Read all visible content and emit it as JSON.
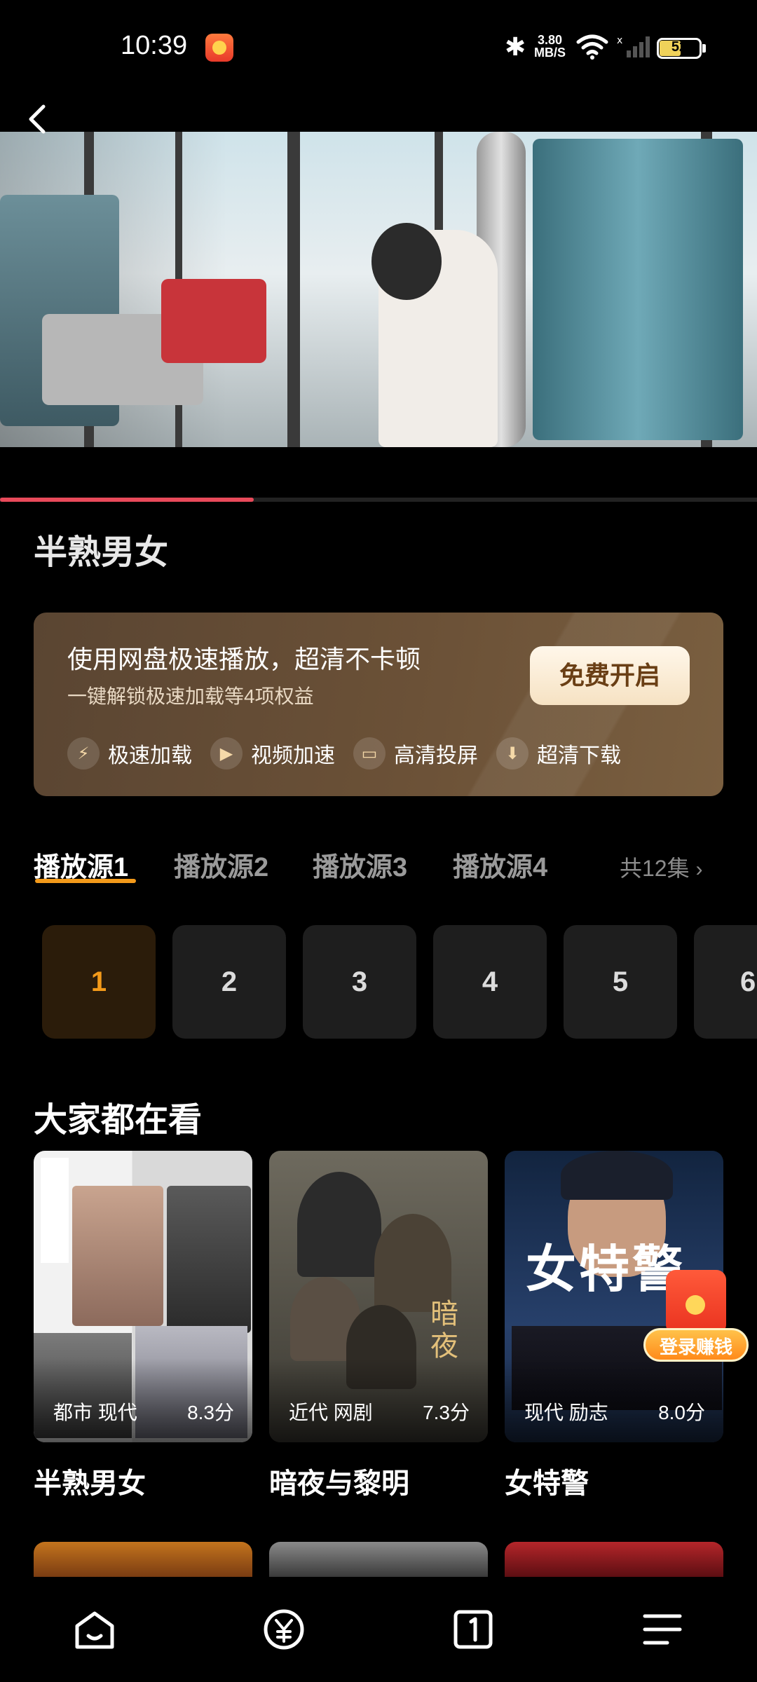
{
  "status_bar": {
    "time": "10:39",
    "network_speed_value": "3.80",
    "network_speed_unit": "MB/S",
    "battery": "52"
  },
  "video": {
    "progress_fraction": 0.335
  },
  "title": "半熟男女",
  "promo": {
    "title": "使用网盘极速播放，超清不卡顿",
    "subtitle": "一键解锁极速加载等4项权益",
    "button": "免费开启",
    "features": [
      {
        "icon": "lightning-icon",
        "label": "极速加载"
      },
      {
        "icon": "play-fast-icon",
        "label": "视频加速"
      },
      {
        "icon": "cast-icon",
        "label": "高清投屏"
      },
      {
        "icon": "download-icon",
        "label": "超清下载"
      }
    ],
    "colors": {
      "card": "#6b5137",
      "button_text": "#6a3f15"
    }
  },
  "sources": {
    "tabs": [
      "播放源1",
      "播放源2",
      "播放源3",
      "播放源4"
    ],
    "active_index": 0,
    "episode_count": "共12集"
  },
  "episodes": {
    "items": [
      "1",
      "2",
      "3",
      "4",
      "5",
      "6"
    ],
    "active_index": 0,
    "accent_color": "#f39a1a"
  },
  "popular": {
    "title": "大家都在看",
    "items": [
      {
        "name": "半熟男女",
        "tags": "都市 现代",
        "score": "8.3分"
      },
      {
        "name": "暗夜与黎明",
        "tags": "近代 网剧",
        "score": "7.3分"
      },
      {
        "name": "女特警",
        "tags": "现代 励志",
        "score": "8.0分"
      }
    ]
  },
  "reward": {
    "label": "登录赚钱"
  },
  "bottom_nav": {
    "items": [
      "home-icon",
      "yuan-icon",
      "number-one-icon",
      "menu-icon"
    ]
  }
}
